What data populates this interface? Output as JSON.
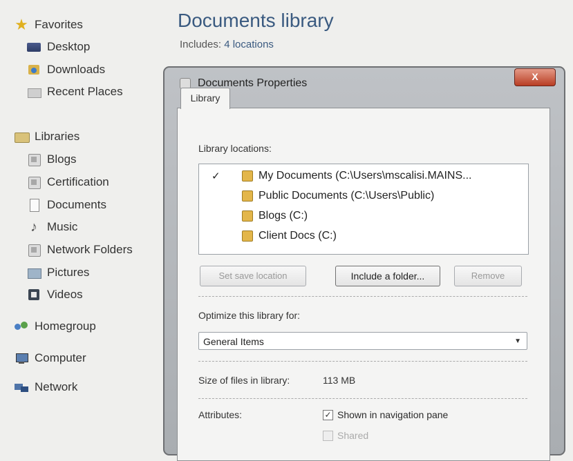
{
  "nav": {
    "favorites": "Favorites",
    "desktop": "Desktop",
    "downloads": "Downloads",
    "recent_places": "Recent Places",
    "libraries": "Libraries",
    "library_items": [
      "Blogs",
      "Certification",
      "Documents",
      "Music",
      "Network Folders",
      "Pictures",
      "Videos"
    ],
    "homegroup": "Homegroup",
    "computer": "Computer",
    "network": "Network"
  },
  "library": {
    "title": "Documents library",
    "includes_label": "Includes:",
    "includes_value": "4 locations"
  },
  "dialog": {
    "title": "Documents Properties",
    "close": "X",
    "tab": "Library",
    "locations_label": "Library locations:",
    "locations": [
      {
        "name": "My Documents (C:\\Users\\mscalisi.MAINS...",
        "checked": true
      },
      {
        "name": "Public Documents (C:\\Users\\Public)",
        "checked": false
      },
      {
        "name": "Blogs (C:)",
        "checked": false
      },
      {
        "name": "Client Docs (C:)",
        "checked": false
      }
    ],
    "check_mark": "✓",
    "set_save_location": "Set save location",
    "include_folder": "Include a folder...",
    "remove": "Remove",
    "optimize_label": "Optimize this library for:",
    "optimize_value": "General Items",
    "size_label": "Size of files in library:",
    "size_value": "113 MB",
    "attributes_label": "Attributes:",
    "shown_in_nav": "Shown in navigation pane",
    "shown_in_nav_checked": true,
    "shared": "Shared",
    "shared_checked": false
  }
}
